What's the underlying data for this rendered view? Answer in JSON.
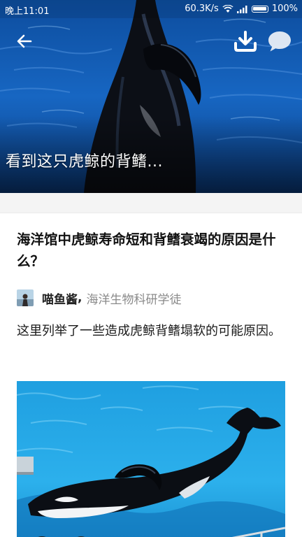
{
  "status_bar": {
    "time": "晚上11:01",
    "network_speed": "60.3K/s",
    "battery": "100%"
  },
  "hero": {
    "title": "看到这只虎鲸的背鳍..."
  },
  "toolbar": {
    "back_icon": "arrow-left-icon",
    "download_icon": "download-icon",
    "comment_icon": "comment-bubble-icon"
  },
  "article": {
    "question_title": "海洋馆中虎鲸寿命短和背鳍衰竭的原因是什么？",
    "author": {
      "name": "喵鱼酱",
      "separator": ",",
      "bio": "海洋生物科研学徒"
    },
    "body": "这里列举了一些造成虎鲸背鳍塌软的可能原因。"
  },
  "colors": {
    "hero_water": "#1565c0",
    "pool_water": "#29a8e6",
    "title_text": "#111111",
    "bio_text": "#8a8a8a"
  }
}
